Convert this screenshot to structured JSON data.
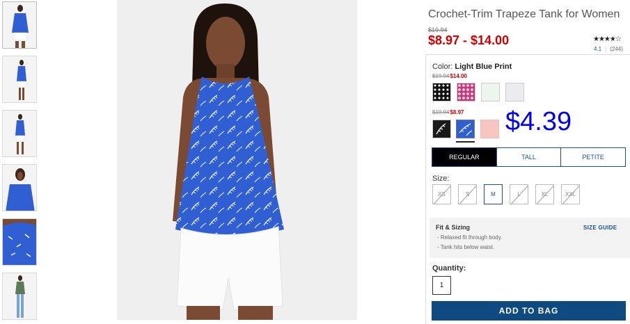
{
  "product": {
    "title": "Crochet-Trim Trapeze Tank for Women",
    "original_price": "$19.94",
    "sale_price": "$8.97 - $14.00",
    "rating_stars": "★★★★☆",
    "rating_value": "4.1",
    "review_count": "(244)"
  },
  "color": {
    "label": "Color:",
    "selected_name": "Light Blue Print",
    "groups": [
      {
        "original_price": "$19.94",
        "sale_price": "$14.00",
        "swatches": [
          "black-white-dot",
          "pink-print",
          "mint-print",
          "light-grey"
        ]
      },
      {
        "original_price": "$19.94",
        "sale_price": "$8.97",
        "swatches": [
          "black-leaf-print",
          "light-blue-print",
          "blush-pink"
        ]
      }
    ],
    "selected_swatch": "light-blue-print"
  },
  "promo_price": "$4.39",
  "fit": {
    "tabs": [
      "REGULAR",
      "TALL",
      "PETITE"
    ],
    "active": "REGULAR"
  },
  "size": {
    "label": "Size:",
    "options": [
      {
        "label": "XS",
        "available": false
      },
      {
        "label": "S",
        "available": false
      },
      {
        "label": "M",
        "available": true
      },
      {
        "label": "L",
        "available": false
      },
      {
        "label": "XL",
        "available": false
      },
      {
        "label": "XXL",
        "available": false
      }
    ]
  },
  "fit_sizing": {
    "title": "Fit & Sizing",
    "items": [
      "Relaxed fit through body.",
      "Tank hits below waist."
    ],
    "guide_label": "SIZE GUIDE"
  },
  "quantity": {
    "label": "Quantity:",
    "value": "1"
  },
  "add_to_bag_label": "ADD TO BAG",
  "colors": {
    "sale_red": "#cc0000",
    "brand_blue": "#0f4a80",
    "promo_blue": "#0000ee",
    "shirt_blue": "#2f5fd3"
  }
}
